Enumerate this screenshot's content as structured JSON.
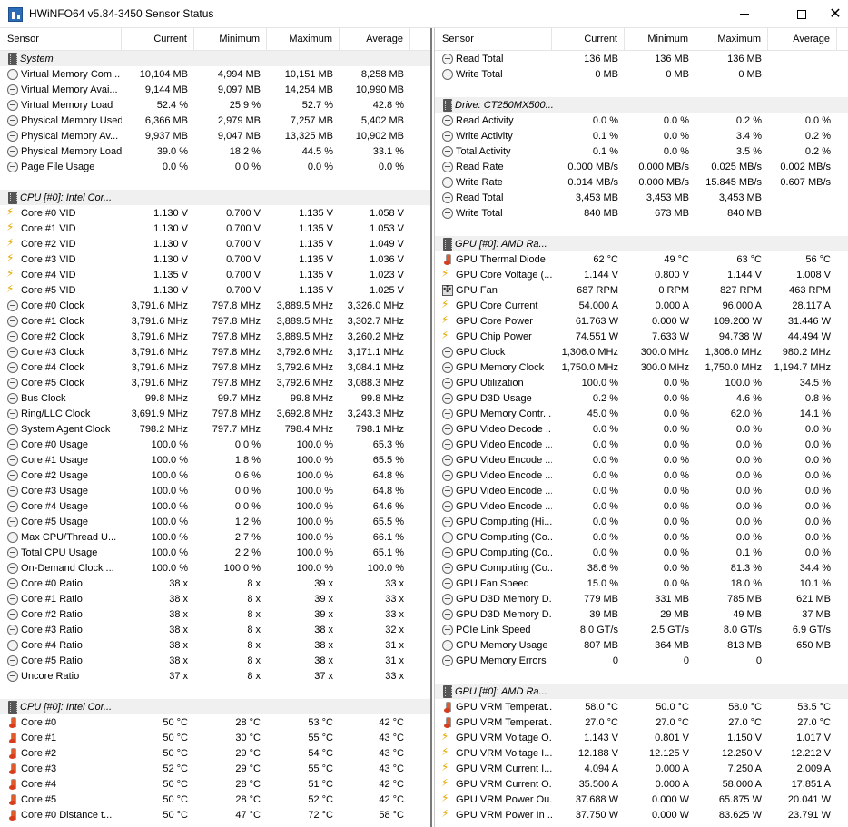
{
  "window": {
    "title": "HWiNFO64 v5.84-3450 Sensor Status",
    "min_icon": "minimize-icon",
    "max_icon": "maximize-icon",
    "close_icon": "close-icon",
    "close_glyph": "✕"
  },
  "columns": [
    "Sensor",
    "Current",
    "Minimum",
    "Maximum",
    "Average"
  ],
  "left": [
    {
      "group": "System"
    },
    {
      "icon": "circle",
      "name": "Virtual Memory Com...",
      "cur": "10,104 MB",
      "min": "4,994 MB",
      "max": "10,151 MB",
      "avg": "8,258 MB"
    },
    {
      "icon": "circle",
      "name": "Virtual Memory Avai...",
      "cur": "9,144 MB",
      "min": "9,097 MB",
      "max": "14,254 MB",
      "avg": "10,990 MB"
    },
    {
      "icon": "circle",
      "name": "Virtual Memory Load",
      "cur": "52.4 %",
      "min": "25.9 %",
      "max": "52.7 %",
      "avg": "42.8 %"
    },
    {
      "icon": "circle",
      "name": "Physical Memory Used",
      "cur": "6,366 MB",
      "min": "2,979 MB",
      "max": "7,257 MB",
      "avg": "5,402 MB"
    },
    {
      "icon": "circle",
      "name": "Physical Memory Av...",
      "cur": "9,937 MB",
      "min": "9,047 MB",
      "max": "13,325 MB",
      "avg": "10,902 MB"
    },
    {
      "icon": "circle",
      "name": "Physical Memory Load",
      "cur": "39.0 %",
      "min": "18.2 %",
      "max": "44.5 %",
      "avg": "33.1 %"
    },
    {
      "icon": "circle",
      "name": "Page File Usage",
      "cur": "0.0 %",
      "min": "0.0 %",
      "max": "0.0 %",
      "avg": "0.0 %"
    },
    {
      "spacer": true
    },
    {
      "group": "CPU [#0]: Intel Cor..."
    },
    {
      "icon": "bolt",
      "name": "Core #0 VID",
      "cur": "1.130 V",
      "min": "0.700 V",
      "max": "1.135 V",
      "avg": "1.058 V"
    },
    {
      "icon": "bolt",
      "name": "Core #1 VID",
      "cur": "1.130 V",
      "min": "0.700 V",
      "max": "1.135 V",
      "avg": "1.053 V"
    },
    {
      "icon": "bolt",
      "name": "Core #2 VID",
      "cur": "1.130 V",
      "min": "0.700 V",
      "max": "1.135 V",
      "avg": "1.049 V"
    },
    {
      "icon": "bolt",
      "name": "Core #3 VID",
      "cur": "1.130 V",
      "min": "0.700 V",
      "max": "1.135 V",
      "avg": "1.036 V"
    },
    {
      "icon": "bolt",
      "name": "Core #4 VID",
      "cur": "1.135 V",
      "min": "0.700 V",
      "max": "1.135 V",
      "avg": "1.023 V"
    },
    {
      "icon": "bolt",
      "name": "Core #5 VID",
      "cur": "1.130 V",
      "min": "0.700 V",
      "max": "1.135 V",
      "avg": "1.025 V"
    },
    {
      "icon": "circle",
      "name": "Core #0 Clock",
      "cur": "3,791.6 MHz",
      "min": "797.8 MHz",
      "max": "3,889.5 MHz",
      "avg": "3,326.0 MHz"
    },
    {
      "icon": "circle",
      "name": "Core #1 Clock",
      "cur": "3,791.6 MHz",
      "min": "797.8 MHz",
      "max": "3,889.5 MHz",
      "avg": "3,302.7 MHz"
    },
    {
      "icon": "circle",
      "name": "Core #2 Clock",
      "cur": "3,791.6 MHz",
      "min": "797.8 MHz",
      "max": "3,889.5 MHz",
      "avg": "3,260.2 MHz"
    },
    {
      "icon": "circle",
      "name": "Core #3 Clock",
      "cur": "3,791.6 MHz",
      "min": "797.8 MHz",
      "max": "3,792.6 MHz",
      "avg": "3,171.1 MHz"
    },
    {
      "icon": "circle",
      "name": "Core #4 Clock",
      "cur": "3,791.6 MHz",
      "min": "797.8 MHz",
      "max": "3,792.6 MHz",
      "avg": "3,084.1 MHz"
    },
    {
      "icon": "circle",
      "name": "Core #5 Clock",
      "cur": "3,791.6 MHz",
      "min": "797.8 MHz",
      "max": "3,792.6 MHz",
      "avg": "3,088.3 MHz"
    },
    {
      "icon": "circle",
      "name": "Bus Clock",
      "cur": "99.8 MHz",
      "min": "99.7 MHz",
      "max": "99.8 MHz",
      "avg": "99.8 MHz"
    },
    {
      "icon": "circle",
      "name": "Ring/LLC Clock",
      "cur": "3,691.9 MHz",
      "min": "797.8 MHz",
      "max": "3,692.8 MHz",
      "avg": "3,243.3 MHz"
    },
    {
      "icon": "circle",
      "name": "System Agent Clock",
      "cur": "798.2 MHz",
      "min": "797.7 MHz",
      "max": "798.4 MHz",
      "avg": "798.1 MHz"
    },
    {
      "icon": "circle",
      "name": "Core #0 Usage",
      "cur": "100.0 %",
      "min": "0.0 %",
      "max": "100.0 %",
      "avg": "65.3 %"
    },
    {
      "icon": "circle",
      "name": "Core #1 Usage",
      "cur": "100.0 %",
      "min": "1.8 %",
      "max": "100.0 %",
      "avg": "65.5 %"
    },
    {
      "icon": "circle",
      "name": "Core #2 Usage",
      "cur": "100.0 %",
      "min": "0.6 %",
      "max": "100.0 %",
      "avg": "64.8 %"
    },
    {
      "icon": "circle",
      "name": "Core #3 Usage",
      "cur": "100.0 %",
      "min": "0.0 %",
      "max": "100.0 %",
      "avg": "64.8 %"
    },
    {
      "icon": "circle",
      "name": "Core #4 Usage",
      "cur": "100.0 %",
      "min": "0.0 %",
      "max": "100.0 %",
      "avg": "64.6 %"
    },
    {
      "icon": "circle",
      "name": "Core #5 Usage",
      "cur": "100.0 %",
      "min": "1.2 %",
      "max": "100.0 %",
      "avg": "65.5 %"
    },
    {
      "icon": "circle",
      "name": "Max CPU/Thread U...",
      "cur": "100.0 %",
      "min": "2.7 %",
      "max": "100.0 %",
      "avg": "66.1 %"
    },
    {
      "icon": "circle",
      "name": "Total CPU Usage",
      "cur": "100.0 %",
      "min": "2.2 %",
      "max": "100.0 %",
      "avg": "65.1 %"
    },
    {
      "icon": "circle",
      "name": "On-Demand Clock ...",
      "cur": "100.0 %",
      "min": "100.0 %",
      "max": "100.0 %",
      "avg": "100.0 %"
    },
    {
      "icon": "circle",
      "name": "Core #0 Ratio",
      "cur": "38 x",
      "min": "8 x",
      "max": "39 x",
      "avg": "33 x"
    },
    {
      "icon": "circle",
      "name": "Core #1 Ratio",
      "cur": "38 x",
      "min": "8 x",
      "max": "39 x",
      "avg": "33 x"
    },
    {
      "icon": "circle",
      "name": "Core #2 Ratio",
      "cur": "38 x",
      "min": "8 x",
      "max": "39 x",
      "avg": "33 x"
    },
    {
      "icon": "circle",
      "name": "Core #3 Ratio",
      "cur": "38 x",
      "min": "8 x",
      "max": "38 x",
      "avg": "32 x"
    },
    {
      "icon": "circle",
      "name": "Core #4 Ratio",
      "cur": "38 x",
      "min": "8 x",
      "max": "38 x",
      "avg": "31 x"
    },
    {
      "icon": "circle",
      "name": "Core #5 Ratio",
      "cur": "38 x",
      "min": "8 x",
      "max": "38 x",
      "avg": "31 x"
    },
    {
      "icon": "circle",
      "name": "Uncore Ratio",
      "cur": "37 x",
      "min": "8 x",
      "max": "37 x",
      "avg": "33 x"
    },
    {
      "spacer": true
    },
    {
      "group": "CPU [#0]: Intel Cor..."
    },
    {
      "icon": "therm",
      "name": "Core #0",
      "cur": "50 °C",
      "min": "28 °C",
      "max": "53 °C",
      "avg": "42 °C"
    },
    {
      "icon": "therm",
      "name": "Core #1",
      "cur": "50 °C",
      "min": "30 °C",
      "max": "55 °C",
      "avg": "43 °C"
    },
    {
      "icon": "therm",
      "name": "Core #2",
      "cur": "50 °C",
      "min": "29 °C",
      "max": "54 °C",
      "avg": "43 °C"
    },
    {
      "icon": "therm",
      "name": "Core #3",
      "cur": "52 °C",
      "min": "29 °C",
      "max": "55 °C",
      "avg": "43 °C"
    },
    {
      "icon": "therm",
      "name": "Core #4",
      "cur": "50 °C",
      "min": "28 °C",
      "max": "51 °C",
      "avg": "42 °C"
    },
    {
      "icon": "therm",
      "name": "Core #5",
      "cur": "50 °C",
      "min": "28 °C",
      "max": "52 °C",
      "avg": "42 °C"
    },
    {
      "icon": "therm",
      "name": "Core #0 Distance t...",
      "cur": "50 °C",
      "min": "47 °C",
      "max": "72 °C",
      "avg": "58 °C"
    }
  ],
  "right": [
    {
      "icon": "circle",
      "name": "Read Total",
      "cur": "136 MB",
      "min": "136 MB",
      "max": "136 MB",
      "avg": ""
    },
    {
      "icon": "circle",
      "name": "Write Total",
      "cur": "0 MB",
      "min": "0 MB",
      "max": "0 MB",
      "avg": ""
    },
    {
      "spacer": true
    },
    {
      "group": "Drive: CT250MX500..."
    },
    {
      "icon": "circle",
      "name": "Read Activity",
      "cur": "0.0 %",
      "min": "0.0 %",
      "max": "0.2 %",
      "avg": "0.0 %"
    },
    {
      "icon": "circle",
      "name": "Write Activity",
      "cur": "0.1 %",
      "min": "0.0 %",
      "max": "3.4 %",
      "avg": "0.2 %"
    },
    {
      "icon": "circle",
      "name": "Total Activity",
      "cur": "0.1 %",
      "min": "0.0 %",
      "max": "3.5 %",
      "avg": "0.2 %"
    },
    {
      "icon": "circle",
      "name": "Read Rate",
      "cur": "0.000 MB/s",
      "min": "0.000 MB/s",
      "max": "0.025 MB/s",
      "avg": "0.002 MB/s"
    },
    {
      "icon": "circle",
      "name": "Write Rate",
      "cur": "0.014 MB/s",
      "min": "0.000 MB/s",
      "max": "15.845 MB/s",
      "avg": "0.607 MB/s"
    },
    {
      "icon": "circle",
      "name": "Read Total",
      "cur": "3,453 MB",
      "min": "3,453 MB",
      "max": "3,453 MB",
      "avg": ""
    },
    {
      "icon": "circle",
      "name": "Write Total",
      "cur": "840 MB",
      "min": "673 MB",
      "max": "840 MB",
      "avg": ""
    },
    {
      "spacer": true
    },
    {
      "group": "GPU [#0]: AMD Ra..."
    },
    {
      "icon": "therm",
      "name": "GPU Thermal Diode",
      "cur": "62 °C",
      "min": "49 °C",
      "max": "63 °C",
      "avg": "56 °C"
    },
    {
      "icon": "bolt",
      "name": "GPU Core Voltage (...",
      "cur": "1.144 V",
      "min": "0.800 V",
      "max": "1.144 V",
      "avg": "1.008 V"
    },
    {
      "icon": "fan",
      "name": "GPU Fan",
      "cur": "687 RPM",
      "min": "0 RPM",
      "max": "827 RPM",
      "avg": "463 RPM"
    },
    {
      "icon": "bolt",
      "name": "GPU Core Current",
      "cur": "54.000 A",
      "min": "0.000 A",
      "max": "96.000 A",
      "avg": "28.117 A"
    },
    {
      "icon": "bolt",
      "name": "GPU Core Power",
      "cur": "61.763 W",
      "min": "0.000 W",
      "max": "109.200 W",
      "avg": "31.446 W"
    },
    {
      "icon": "bolt",
      "name": "GPU Chip Power",
      "cur": "74.551 W",
      "min": "7.633 W",
      "max": "94.738 W",
      "avg": "44.494 W"
    },
    {
      "icon": "circle",
      "name": "GPU Clock",
      "cur": "1,306.0 MHz",
      "min": "300.0 MHz",
      "max": "1,306.0 MHz",
      "avg": "980.2 MHz"
    },
    {
      "icon": "circle",
      "name": "GPU Memory Clock",
      "cur": "1,750.0 MHz",
      "min": "300.0 MHz",
      "max": "1,750.0 MHz",
      "avg": "1,194.7 MHz"
    },
    {
      "icon": "circle",
      "name": "GPU Utilization",
      "cur": "100.0 %",
      "min": "0.0 %",
      "max": "100.0 %",
      "avg": "34.5 %"
    },
    {
      "icon": "circle",
      "name": "GPU D3D Usage",
      "cur": "0.2 %",
      "min": "0.0 %",
      "max": "4.6 %",
      "avg": "0.8 %"
    },
    {
      "icon": "circle",
      "name": "GPU Memory Contr...",
      "cur": "45.0 %",
      "min": "0.0 %",
      "max": "62.0 %",
      "avg": "14.1 %"
    },
    {
      "icon": "circle",
      "name": "GPU Video Decode ...",
      "cur": "0.0 %",
      "min": "0.0 %",
      "max": "0.0 %",
      "avg": "0.0 %"
    },
    {
      "icon": "circle",
      "name": "GPU Video Encode ...",
      "cur": "0.0 %",
      "min": "0.0 %",
      "max": "0.0 %",
      "avg": "0.0 %"
    },
    {
      "icon": "circle",
      "name": "GPU Video Encode ...",
      "cur": "0.0 %",
      "min": "0.0 %",
      "max": "0.0 %",
      "avg": "0.0 %"
    },
    {
      "icon": "circle",
      "name": "GPU Video Encode ...",
      "cur": "0.0 %",
      "min": "0.0 %",
      "max": "0.0 %",
      "avg": "0.0 %"
    },
    {
      "icon": "circle",
      "name": "GPU Video Encode ...",
      "cur": "0.0 %",
      "min": "0.0 %",
      "max": "0.0 %",
      "avg": "0.0 %"
    },
    {
      "icon": "circle",
      "name": "GPU Video Encode ...",
      "cur": "0.0 %",
      "min": "0.0 %",
      "max": "0.0 %",
      "avg": "0.0 %"
    },
    {
      "icon": "circle",
      "name": "GPU Computing (Hi...",
      "cur": "0.0 %",
      "min": "0.0 %",
      "max": "0.0 %",
      "avg": "0.0 %"
    },
    {
      "icon": "circle",
      "name": "GPU Computing (Co...",
      "cur": "0.0 %",
      "min": "0.0 %",
      "max": "0.0 %",
      "avg": "0.0 %"
    },
    {
      "icon": "circle",
      "name": "GPU Computing (Co...",
      "cur": "0.0 %",
      "min": "0.0 %",
      "max": "0.1 %",
      "avg": "0.0 %"
    },
    {
      "icon": "circle",
      "name": "GPU Computing (Co...",
      "cur": "38.6 %",
      "min": "0.0 %",
      "max": "81.3 %",
      "avg": "34.4 %"
    },
    {
      "icon": "circle",
      "name": "GPU Fan Speed",
      "cur": "15.0 %",
      "min": "0.0 %",
      "max": "18.0 %",
      "avg": "10.1 %"
    },
    {
      "icon": "circle",
      "name": "GPU D3D Memory D...",
      "cur": "779 MB",
      "min": "331 MB",
      "max": "785 MB",
      "avg": "621 MB"
    },
    {
      "icon": "circle",
      "name": "GPU D3D Memory D...",
      "cur": "39 MB",
      "min": "29 MB",
      "max": "49 MB",
      "avg": "37 MB"
    },
    {
      "icon": "circle",
      "name": "PCIe Link Speed",
      "cur": "8.0 GT/s",
      "min": "2.5 GT/s",
      "max": "8.0 GT/s",
      "avg": "6.9 GT/s"
    },
    {
      "icon": "circle",
      "name": "GPU Memory Usage",
      "cur": "807 MB",
      "min": "364 MB",
      "max": "813 MB",
      "avg": "650 MB"
    },
    {
      "icon": "circle",
      "name": "GPU Memory Errors",
      "cur": "0",
      "min": "0",
      "max": "0",
      "avg": ""
    },
    {
      "spacer": true
    },
    {
      "group": "GPU [#0]: AMD Ra..."
    },
    {
      "icon": "therm",
      "name": "GPU VRM Temperat...",
      "cur": "58.0 °C",
      "min": "50.0 °C",
      "max": "58.0 °C",
      "avg": "53.5 °C"
    },
    {
      "icon": "therm",
      "name": "GPU VRM Temperat...",
      "cur": "27.0 °C",
      "min": "27.0 °C",
      "max": "27.0 °C",
      "avg": "27.0 °C"
    },
    {
      "icon": "bolt",
      "name": "GPU VRM Voltage O...",
      "cur": "1.143 V",
      "min": "0.801 V",
      "max": "1.150 V",
      "avg": "1.017 V"
    },
    {
      "icon": "bolt",
      "name": "GPU VRM Voltage I...",
      "cur": "12.188 V",
      "min": "12.125 V",
      "max": "12.250 V",
      "avg": "12.212 V"
    },
    {
      "icon": "bolt",
      "name": "GPU VRM Current I...",
      "cur": "4.094 A",
      "min": "0.000 A",
      "max": "7.250 A",
      "avg": "2.009 A"
    },
    {
      "icon": "bolt",
      "name": "GPU VRM Current O...",
      "cur": "35.500 A",
      "min": "0.000 A",
      "max": "58.000 A",
      "avg": "17.851 A"
    },
    {
      "icon": "bolt",
      "name": "GPU VRM Power Ou...",
      "cur": "37.688 W",
      "min": "0.000 W",
      "max": "65.875 W",
      "avg": "20.041 W"
    },
    {
      "icon": "bolt",
      "name": "GPU VRM Power In ...",
      "cur": "37.750 W",
      "min": "0.000 W",
      "max": "83.625 W",
      "avg": "23.791 W"
    }
  ]
}
